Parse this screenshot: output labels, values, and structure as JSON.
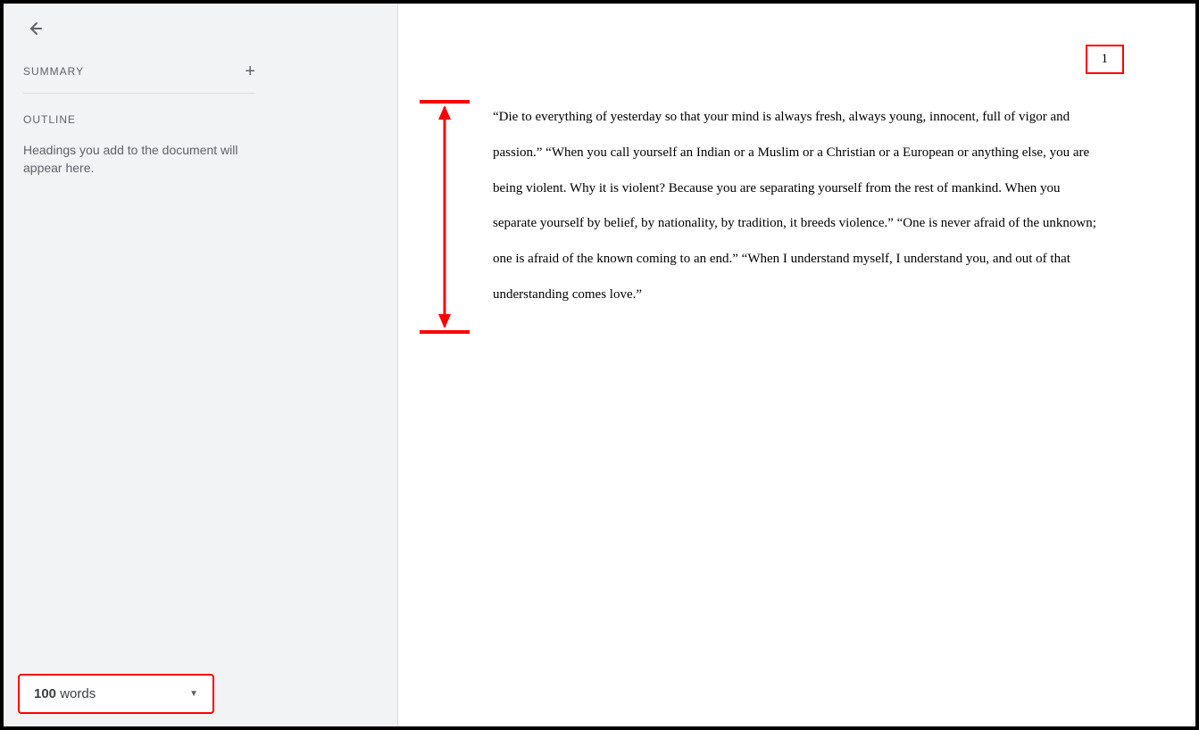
{
  "sidebar": {
    "summary_label": "SUMMARY",
    "add_symbol": "+",
    "outline_label": "OUTLINE",
    "outline_hint": "Headings you add to the document will appear here.",
    "word_count_number": "100",
    "word_count_unit": "words"
  },
  "document": {
    "page_number": "1",
    "body_text": "“Die to everything of yesterday so that your mind is always fresh, always young, innocent, full of vigor and passion.” “When you call yourself an Indian or a Muslim or a Christian or a European or anything else, you are being violent. Why it is violent? Because you are separating yourself from the rest of mankind. When you separate yourself by belief, by nationality, by tradition, it breeds violence.” “One is never afraid of the unknown; one is afraid of the known coming to an end.” “When I understand myself, I understand you, and out of that understanding comes love.”"
  },
  "annotation": {
    "color": "#ff0000"
  }
}
